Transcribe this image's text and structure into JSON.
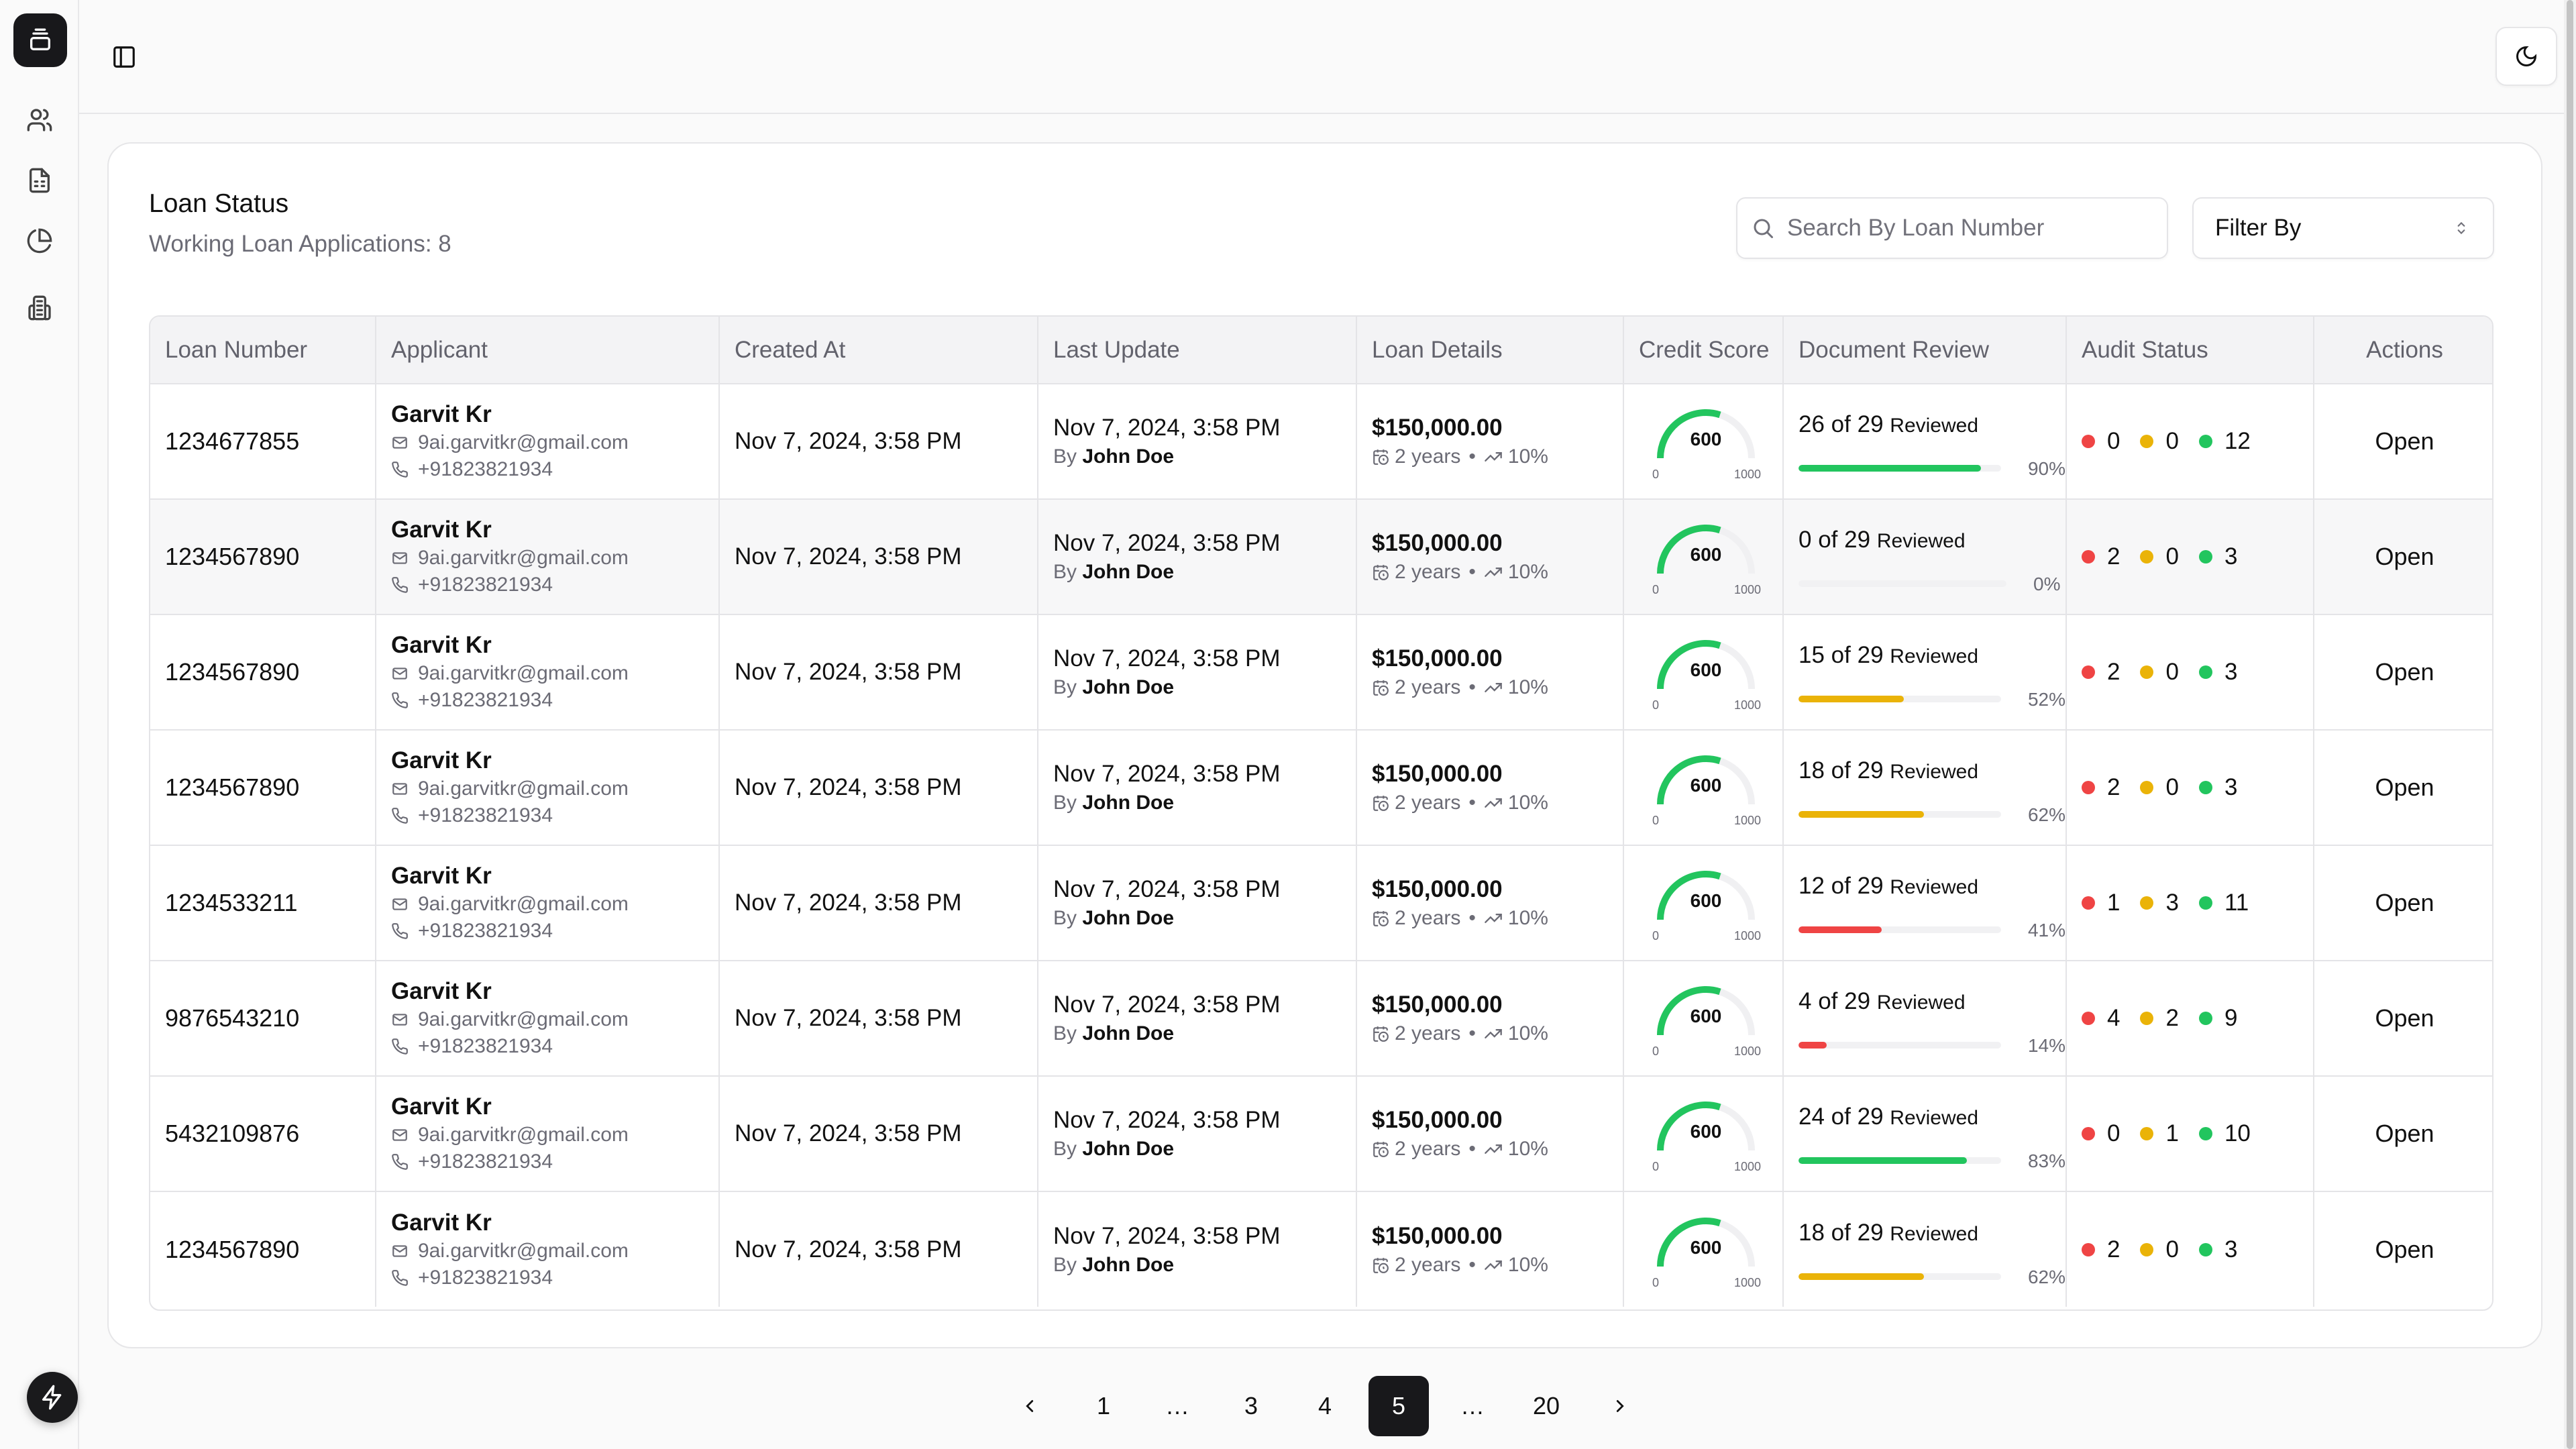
{
  "app": {
    "sidebar": {
      "items": [
        {
          "name": "users",
          "icon": "users-icon"
        },
        {
          "name": "documents",
          "icon": "file-spreadsheet-icon"
        },
        {
          "name": "analytics",
          "icon": "pie-chart-icon"
        },
        {
          "name": "organizations",
          "icon": "building-icon"
        }
      ],
      "logo_icon": "archive-icon",
      "fab_icon": "lightning-icon"
    },
    "topbar": {
      "toggle_icon": "panel-left-icon",
      "theme_icon": "moon-icon"
    }
  },
  "card": {
    "title": "Loan Status",
    "subtitle": "Working Loan Applications: 8",
    "search": {
      "placeholder": "Search By Loan Number",
      "value": ""
    },
    "filter": {
      "label": "Filter By"
    }
  },
  "table": {
    "headers": [
      "Loan Number",
      "Applicant",
      "Created At",
      "Last Update",
      "Loan Details",
      "Credit Score",
      "Document Review",
      "Audit Status",
      "Actions"
    ],
    "rows": [
      {
        "loan_number": "1234677855",
        "name": "Garvit Kr",
        "email": "9ai.garvitkr@gmail.com",
        "phone": "+91823821934",
        "created_at": "Nov 7, 2024, 3:58 PM",
        "updated_at": "Nov 7, 2024, 3:58 PM",
        "by_label": "By",
        "updated_by": "John Doe",
        "amount": "$150,000.00",
        "term": "2 years",
        "rate": "10%",
        "credit_score": 600,
        "credit_min": "0",
        "credit_max": "1000",
        "reviewed": "26",
        "of_label": "of",
        "total": "29",
        "reviewed_label": "Reviewed",
        "percent": "90%",
        "progress": 0.9,
        "bar_color": "#22c55e",
        "audit": {
          "red": "0",
          "yellow": "0",
          "green": "12"
        },
        "action": "Open"
      },
      {
        "loan_number": "1234567890",
        "name": "Garvit Kr",
        "email": "9ai.garvitkr@gmail.com",
        "phone": "+91823821934",
        "created_at": "Nov 7, 2024, 3:58 PM",
        "updated_at": "Nov 7, 2024, 3:58 PM",
        "by_label": "By",
        "updated_by": "John Doe",
        "amount": "$150,000.00",
        "term": "2 years",
        "rate": "10%",
        "credit_score": 600,
        "credit_min": "0",
        "credit_max": "1000",
        "reviewed": "0",
        "of_label": "of",
        "total": "29",
        "reviewed_label": "Reviewed",
        "percent": "0%",
        "progress": 0.0,
        "bar_color": "#ef4444",
        "audit": {
          "red": "2",
          "yellow": "0",
          "green": "3"
        },
        "action": "Open",
        "hover": true
      },
      {
        "loan_number": "1234567890",
        "name": "Garvit Kr",
        "email": "9ai.garvitkr@gmail.com",
        "phone": "+91823821934",
        "created_at": "Nov 7, 2024, 3:58 PM",
        "updated_at": "Nov 7, 2024, 3:58 PM",
        "by_label": "By",
        "updated_by": "John Doe",
        "amount": "$150,000.00",
        "term": "2 years",
        "rate": "10%",
        "credit_score": 600,
        "credit_min": "0",
        "credit_max": "1000",
        "reviewed": "15",
        "of_label": "of",
        "total": "29",
        "reviewed_label": "Reviewed",
        "percent": "52%",
        "progress": 0.52,
        "bar_color": "#eab308",
        "audit": {
          "red": "2",
          "yellow": "0",
          "green": "3"
        },
        "action": "Open"
      },
      {
        "loan_number": "1234567890",
        "name": "Garvit Kr",
        "email": "9ai.garvitkr@gmail.com",
        "phone": "+91823821934",
        "created_at": "Nov 7, 2024, 3:58 PM",
        "updated_at": "Nov 7, 2024, 3:58 PM",
        "by_label": "By",
        "updated_by": "John Doe",
        "amount": "$150,000.00",
        "term": "2 years",
        "rate": "10%",
        "credit_score": 600,
        "credit_min": "0",
        "credit_max": "1000",
        "reviewed": "18",
        "of_label": "of",
        "total": "29",
        "reviewed_label": "Reviewed",
        "percent": "62%",
        "progress": 0.62,
        "bar_color": "#eab308",
        "audit": {
          "red": "2",
          "yellow": "0",
          "green": "3"
        },
        "action": "Open"
      },
      {
        "loan_number": "1234533211",
        "name": "Garvit Kr",
        "email": "9ai.garvitkr@gmail.com",
        "phone": "+91823821934",
        "created_at": "Nov 7, 2024, 3:58 PM",
        "updated_at": "Nov 7, 2024, 3:58 PM",
        "by_label": "By",
        "updated_by": "John Doe",
        "amount": "$150,000.00",
        "term": "2 years",
        "rate": "10%",
        "credit_score": 600,
        "credit_min": "0",
        "credit_max": "1000",
        "reviewed": "12",
        "of_label": "of",
        "total": "29",
        "reviewed_label": "Reviewed",
        "percent": "41%",
        "progress": 0.41,
        "bar_color": "#ef4444",
        "audit": {
          "red": "1",
          "yellow": "3",
          "green": "11"
        },
        "action": "Open"
      },
      {
        "loan_number": "9876543210",
        "name": "Garvit Kr",
        "email": "9ai.garvitkr@gmail.com",
        "phone": "+91823821934",
        "created_at": "Nov 7, 2024, 3:58 PM",
        "updated_at": "Nov 7, 2024, 3:58 PM",
        "by_label": "By",
        "updated_by": "John Doe",
        "amount": "$150,000.00",
        "term": "2 years",
        "rate": "10%",
        "credit_score": 600,
        "credit_min": "0",
        "credit_max": "1000",
        "reviewed": "4",
        "of_label": "of",
        "total": "29",
        "reviewed_label": "Reviewed",
        "percent": "14%",
        "progress": 0.14,
        "bar_color": "#ef4444",
        "audit": {
          "red": "4",
          "yellow": "2",
          "green": "9"
        },
        "action": "Open"
      },
      {
        "loan_number": "5432109876",
        "name": "Garvit Kr",
        "email": "9ai.garvitkr@gmail.com",
        "phone": "+91823821934",
        "created_at": "Nov 7, 2024, 3:58 PM",
        "updated_at": "Nov 7, 2024, 3:58 PM",
        "by_label": "By",
        "updated_by": "John Doe",
        "amount": "$150,000.00",
        "term": "2 years",
        "rate": "10%",
        "credit_score": 600,
        "credit_min": "0",
        "credit_max": "1000",
        "reviewed": "24",
        "of_label": "of",
        "total": "29",
        "reviewed_label": "Reviewed",
        "percent": "83%",
        "progress": 0.83,
        "bar_color": "#22c55e",
        "audit": {
          "red": "0",
          "yellow": "1",
          "green": "10"
        },
        "action": "Open"
      },
      {
        "loan_number": "1234567890",
        "name": "Garvit Kr",
        "email": "9ai.garvitkr@gmail.com",
        "phone": "+91823821934",
        "created_at": "Nov 7, 2024, 3:58 PM",
        "updated_at": "Nov 7, 2024, 3:58 PM",
        "by_label": "By",
        "updated_by": "John Doe",
        "amount": "$150,000.00",
        "term": "2 years",
        "rate": "10%",
        "credit_score": 600,
        "credit_min": "0",
        "credit_max": "1000",
        "reviewed": "18",
        "of_label": "of",
        "total": "29",
        "reviewed_label": "Reviewed",
        "percent": "62%",
        "progress": 0.62,
        "bar_color": "#eab308",
        "audit": {
          "red": "2",
          "yellow": "0",
          "green": "3"
        },
        "action": "Open"
      }
    ]
  },
  "colors": {
    "gauge": "#22c55e",
    "gauge_track": "#f0f0f2",
    "audit_red": "#ef4444",
    "audit_yellow": "#eab308",
    "audit_green": "#22c55e",
    "active_page": "#18181b"
  },
  "pagination": {
    "prev": "‹",
    "next": "›",
    "pages": [
      "1",
      "…",
      "3",
      "4",
      "5",
      "…",
      "20"
    ],
    "current": "5"
  }
}
